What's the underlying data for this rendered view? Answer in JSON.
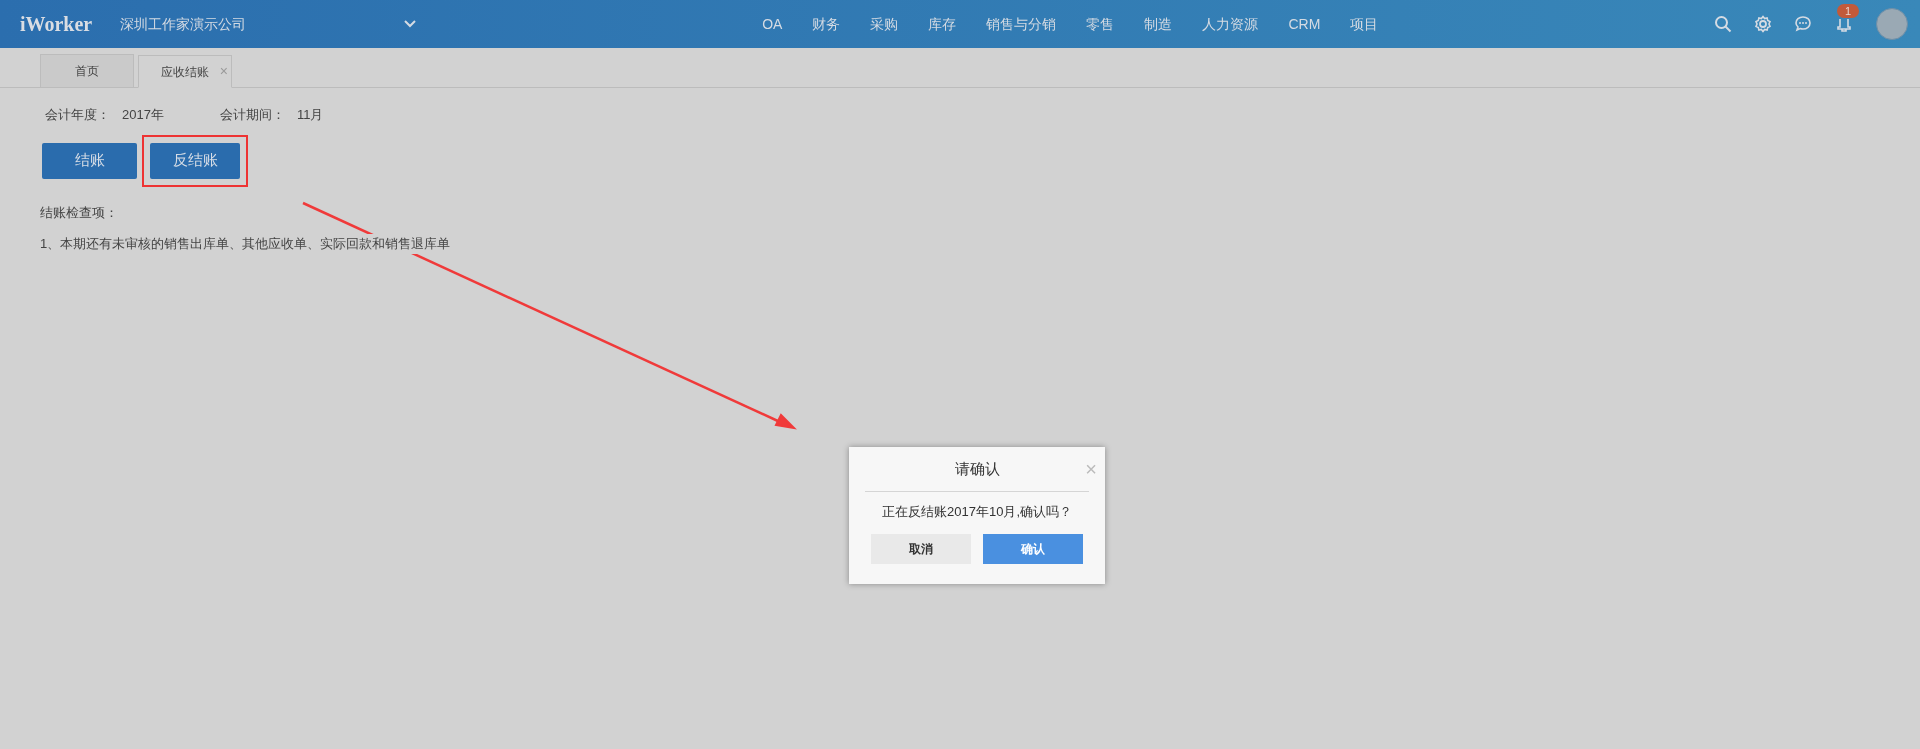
{
  "header": {
    "logo": "iWorker",
    "company": "深圳工作家演示公司",
    "nav": [
      "OA",
      "财务",
      "采购",
      "库存",
      "销售与分销",
      "零售",
      "制造",
      "人力资源",
      "CRM",
      "项目"
    ],
    "notification_count": "1"
  },
  "tabs": [
    {
      "label": "首页",
      "selected": false
    },
    {
      "label": "应收结账",
      "selected": true,
      "close": "×"
    }
  ],
  "fields": [
    {
      "label": "会计年度：",
      "value": "2017年"
    },
    {
      "label": "会计期间：",
      "value": "11月"
    }
  ],
  "buttons": [
    {
      "label": "结账",
      "highlighted": false
    },
    {
      "label": "反结账",
      "highlighted": true
    }
  ],
  "checks": {
    "title": "结账检查项：",
    "items": [
      "1、本期还有未审核的销售出库单、其他应收单、实际回款和销售退库单"
    ]
  },
  "dialog": {
    "title": "请确认",
    "close": "×",
    "message": "正在反结账2017年10月,确认吗？",
    "cancel": "取消",
    "confirm": "确认"
  }
}
